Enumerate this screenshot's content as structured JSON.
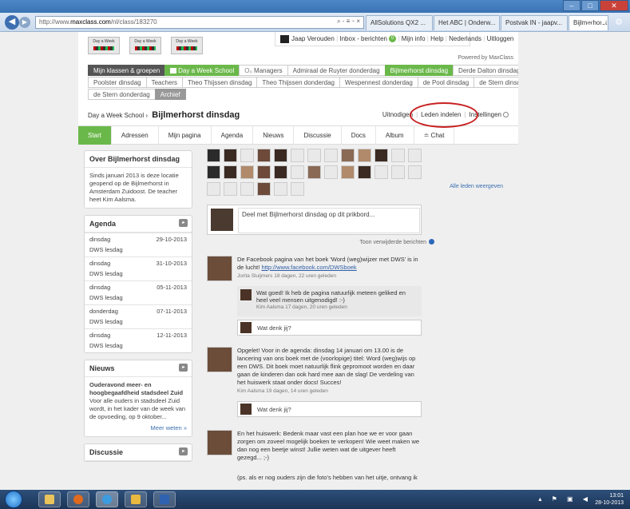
{
  "browser": {
    "url_prefix": "http://www.",
    "url_domain": "maxclass.com",
    "url_path": "/nl/class/183270",
    "url_icons": "⌕ - ≡ ⌁ ×",
    "tabs": [
      {
        "label": "AllSolutions QX2 ..."
      },
      {
        "label": "Het ABC | Onderw..."
      },
      {
        "label": "Postvak IN - jaapv..."
      },
      {
        "label": "Bijlmerhorst di...",
        "close": "×"
      }
    ],
    "right_icons": "⌂ ★ ⚙"
  },
  "window": {
    "min": "–",
    "max": "□",
    "close": "✕"
  },
  "site": {
    "logos": [
      "Day a Week",
      "Day a Week",
      "Day a Week"
    ],
    "user_name": "Jaap Verouden",
    "inbox": "Inbox - berichten",
    "inbox_count": "0",
    "my_info": "Mijn info",
    "help": "Help",
    "language": "Nederlands",
    "logout": "Uitloggen",
    "powered": "Powered by MaxClass",
    "nav_row1": [
      {
        "label": "Mijn klassen & groepen",
        "style": "dark"
      },
      {
        "label": "Day a Week School",
        "style": "green"
      },
      {
        "label": "Managers",
        "style": "plain"
      },
      {
        "label": "Admiraal de Ruyter donderdag",
        "style": "plain"
      },
      {
        "label": "Bijlmerhorst dinsdag",
        "style": "green"
      },
      {
        "label": "Derde Dalton dinsdag",
        "style": "plain"
      }
    ],
    "nav_row2": [
      {
        "label": "Poolster dinsdag"
      },
      {
        "label": "Teachers"
      },
      {
        "label": "Theo Thijssen dinsdag"
      },
      {
        "label": "Theo Thijssen donderdag"
      },
      {
        "label": "Wespennest donderdag"
      },
      {
        "label": "de Pool dinsdag"
      },
      {
        "label": "de Stern dinsdag"
      }
    ],
    "nav_row3": [
      {
        "label": "de Stern donderdag",
        "style": "plain"
      },
      {
        "label": "Archief",
        "style": "grey"
      }
    ]
  },
  "group": {
    "school": "Day a Week School",
    "separator": "›",
    "name": "Bijlmerhorst dinsdag",
    "invite": "Uitnodigen",
    "members": "Leden indelen",
    "settings": "Instellingen"
  },
  "tabs": [
    "Start",
    "Adressen",
    "Mijn pagina",
    "Agenda",
    "Nieuws",
    "Discussie",
    "Docs",
    "Album",
    "≐ Chat"
  ],
  "sidebar": {
    "about_title": "Over Bijlmerhorst dinsdag",
    "about_text": "Sinds januari 2013 is deze locatie geopend op de Bijlmerhorst in Amsterdam Zuidoost. De teacher heet Kim Aalsma.",
    "agenda_title": "Agenda",
    "agenda": [
      {
        "day": "dinsdag",
        "date": "29-10-2013",
        "label": "DWS lesdag"
      },
      {
        "day": "dinsdag",
        "date": "31-10-2013",
        "label": "DWS lesdag"
      },
      {
        "day": "dinsdag",
        "date": "05-11-2013",
        "label": "DWS lesdag"
      },
      {
        "day": "donderdag",
        "date": "07-11-2013",
        "label": "DWS lesdag"
      },
      {
        "day": "dinsdag",
        "date": "12-11-2013",
        "label": "DWS lesdag"
      }
    ],
    "news_title": "Nieuws",
    "news_headline": "Ouderavond meer- en hoogbegaafdheid stadsdeel Zuid",
    "news_text": "Voor alle ouders in stadsdeel Zuid wordt, in het kader van de week van de opvoeding, op 9 oktober...",
    "news_more": "Meer weten »",
    "disc_title": "Discussie"
  },
  "feed": {
    "all_members": "Alle leden weergeven",
    "post_placeholder": "Deel met Bijlmerhorst dinsdag op dit prikbord...",
    "show_deleted": "Toon verwijderde berichten",
    "post1_text": "De Facebook pagina van het boek 'Word (weg)wijzer met DWS' is in de lucht!",
    "post1_link": "http://www.facebook.com/DWSboek",
    "post1_meta": "Jorita Sluijmers 18 dagen, 22 uren geleden",
    "reply1_text": "Wat goed! Ik heb de pagina natuurlijk meteen geliked en heel veel mensen uitgenodigd! :-)",
    "reply1_meta": "Kim Aalsma 17 dagen, 20 uren geleden",
    "comment_prompt": "Wat denk jij?",
    "post2_text": "Opgelet! Voor in de agenda: dinsdag 14 januari om 13.00 is de lancering van ons boek met de (voorlopige) titel: Word (weg)wijs op een DWS. Dit boek moet natuurlijk flink gepromoot worden en daar gaan de kinderen dan ook hard mee aan de slag! De verdeling van het huiswerk staat onder docs! Succes!",
    "post2_meta": "Kim Aalsma 19 dagen, 14 uren geleden",
    "post3_text": "En het huiswerk: Bedenk maar vast een plan hoe we er voor gaan zorgen om zoveel mogelijk boeken te verkopen! Wie weet maken we dan nog een beetje winst! Jullie weten wat de uitgever heeft gezegd... ;-)",
    "post4_text": "(ps. als er nog ouders zijn die foto's hebben van het uitje, ontvang ik"
  },
  "taskbar": {
    "time": "13:01",
    "date": "28-10-2013",
    "tray": "▴ ⚑ ▣ ◀"
  }
}
